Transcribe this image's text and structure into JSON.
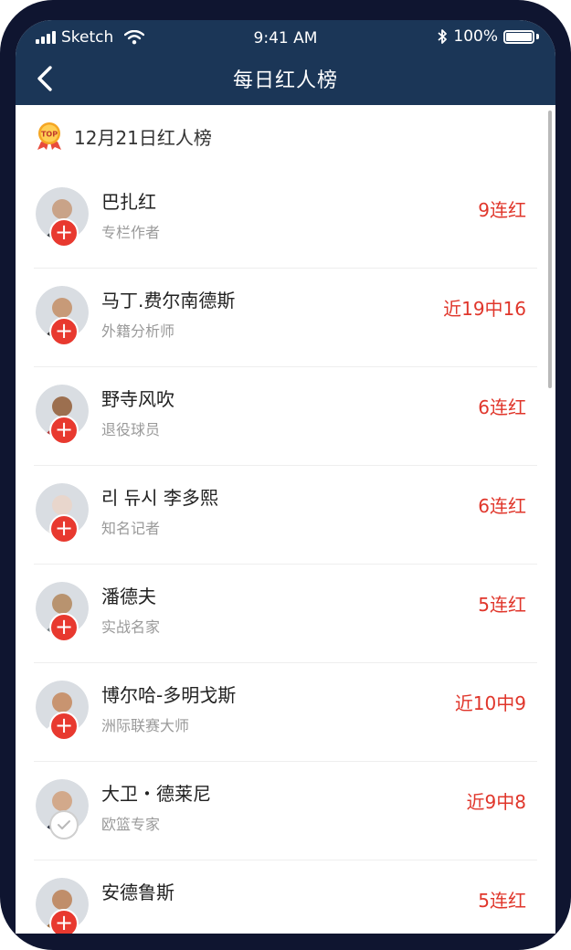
{
  "status_bar": {
    "carrier": "Sketch",
    "time": "9:41 AM",
    "battery": "100%"
  },
  "nav": {
    "title": "每日红人榜",
    "back_icon": "chevron-left-icon"
  },
  "section": {
    "title": "12月21日红人榜",
    "badge_text": "TOP"
  },
  "colors": {
    "header_bg": "#1b3657",
    "accent_red": "#e0362b"
  },
  "list": [
    {
      "name": "巴扎红",
      "title": "专栏作者",
      "streak": "9连红",
      "followed": false,
      "avatar_color": "#3a3f45",
      "skin": "#c9a388"
    },
    {
      "name": "马丁.费尔南德斯",
      "title": "外籍分析师",
      "streak": "近19中16",
      "followed": false,
      "avatar_color": "#2f2f2f",
      "skin": "#c79a78"
    },
    {
      "name": "野寺风吹",
      "title": "退役球员",
      "streak": "6连红",
      "followed": false,
      "avatar_color": "#b23a3a",
      "skin": "#9c6f4f"
    },
    {
      "name": "리 듀시 李多熙",
      "title": "知名记者",
      "streak": "6连红",
      "followed": false,
      "avatar_color": "#e6e6e6",
      "skin": "#e8d6cc"
    },
    {
      "name": "潘德夫",
      "title": "实战名家",
      "streak": "5连红",
      "followed": false,
      "avatar_color": "#6f7a7f",
      "skin": "#b8936f"
    },
    {
      "name": "博尔哈-多明戈斯",
      "title": "洲际联赛大师",
      "streak": "近10中9",
      "followed": false,
      "avatar_color": "#ffffff",
      "skin": "#c89470"
    },
    {
      "name": "大卫・德莱尼",
      "title": "欧篮专家",
      "streak": "近9中8",
      "followed": true,
      "avatar_color": "#2b3140",
      "skin": "#d2a98b"
    },
    {
      "name": "安德鲁斯",
      "title": "",
      "streak": "5连红",
      "followed": false,
      "avatar_color": "#9b6a3c",
      "skin": "#c08e6a"
    }
  ]
}
